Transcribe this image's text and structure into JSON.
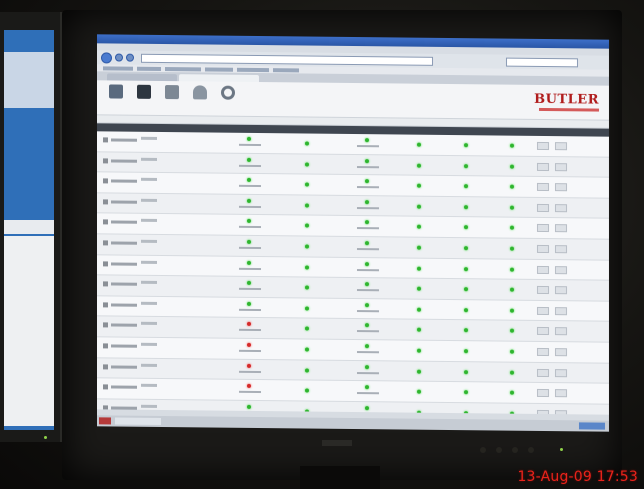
{
  "timestamp": "13-Aug-09 17:53",
  "brand": {
    "logo_text": "BUTLER",
    "logo_color": "#b01c1c"
  },
  "toolbar_icons": [
    "monitoring-icon",
    "chart-icon",
    "bell-icon",
    "gear-icon"
  ],
  "grid_rows": [
    {
      "status": [
        "green",
        "green",
        "green",
        "green",
        "green",
        "green"
      ]
    },
    {
      "status": [
        "green",
        "green",
        "green",
        "green",
        "green",
        "green"
      ]
    },
    {
      "status": [
        "green",
        "green",
        "green",
        "green",
        "green",
        "green"
      ]
    },
    {
      "status": [
        "green",
        "green",
        "green",
        "green",
        "green",
        "green"
      ]
    },
    {
      "status": [
        "green",
        "green",
        "green",
        "green",
        "green",
        "green"
      ]
    },
    {
      "status": [
        "green",
        "green",
        "green",
        "green",
        "green",
        "green"
      ]
    },
    {
      "status": [
        "green",
        "green",
        "green",
        "green",
        "green",
        "green"
      ]
    },
    {
      "status": [
        "green",
        "green",
        "green",
        "green",
        "green",
        "green"
      ]
    },
    {
      "status": [
        "green",
        "green",
        "green",
        "green",
        "green",
        "green"
      ]
    },
    {
      "status": [
        "red",
        "green",
        "green",
        "green",
        "green",
        "green"
      ]
    },
    {
      "status": [
        "red",
        "green",
        "green",
        "green",
        "green",
        "green"
      ]
    },
    {
      "status": [
        "red",
        "green",
        "green",
        "green",
        "green",
        "green"
      ]
    },
    {
      "status": [
        "red",
        "green",
        "green",
        "green",
        "green",
        "green"
      ]
    },
    {
      "status": [
        "green",
        "green",
        "green",
        "green",
        "green",
        "green"
      ]
    }
  ],
  "colors": {
    "ok": "#2fb52f",
    "error": "#d42a2a",
    "header": "#3f4650",
    "timestamp": "#e8231b"
  }
}
